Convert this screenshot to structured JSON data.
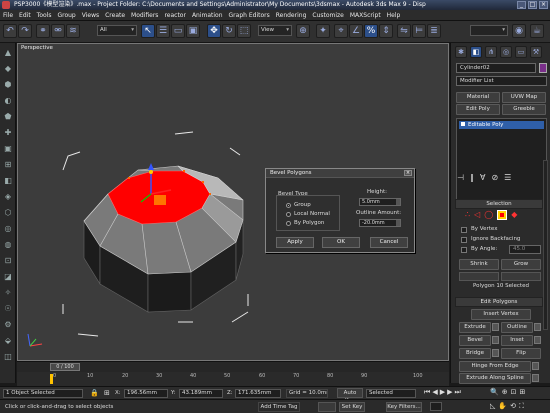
{
  "window": {
    "title": "PSP3000《模型渲染》.max  - Project Folder: C:\\Documents and Settings\\Administrator\\My Documents\\3dsmax  - Autodesk 3ds Max 9  - Disp",
    "minimize": "_",
    "maximize": "□",
    "close": "×"
  },
  "menu": [
    "File",
    "Edit",
    "Tools",
    "Group",
    "Views",
    "Create",
    "Modifiers",
    "reactor",
    "Animation",
    "Graph Editors",
    "Rendering",
    "Customize",
    "MAXScript",
    "Help"
  ],
  "toolbar": {
    "selection_filter": "All",
    "ref_coord": "View"
  },
  "viewport": {
    "label": "Perspective"
  },
  "command_panel": {
    "object_name": "Cylinder02",
    "modifier_list": "Modifier List",
    "buttons": [
      "Material",
      "UVW Map",
      "Edit Poly",
      "Greeble"
    ],
    "stack_item": "Editable Poly",
    "selection_header": "Selection",
    "by_vertex": "By Vertex",
    "ignore_backfacing": "Ignore Backfacing",
    "by_angle": "By Angle:",
    "by_angle_value": "45.0",
    "shrink": "Shrink",
    "grow": "Grow",
    "selection_status": "Polygon 10 Selected",
    "edit_polygons_header": "Edit Polygons",
    "insert_vertex": "Insert Vertex",
    "extrude": "Extrude",
    "outline": "Outline",
    "bevel": "Bevel",
    "inset": "Inset",
    "bridge": "Bridge",
    "flip": "Flip",
    "hinge_from_edge": "Hinge From Edge",
    "extrude_along_spline": "Extrude Along Spline"
  },
  "dialog": {
    "title": "Bevel Polygons",
    "close": "×",
    "bevel_type": "Bevel Type",
    "group": "Group",
    "local_normal": "Local Normal",
    "by_polygon": "By Polygon",
    "height_label": "Height:",
    "height_value": "5.0mm",
    "outline_label": "Outline Amount:",
    "outline_value": "-20.0mm",
    "apply": "Apply",
    "ok": "OK",
    "cancel": "Cancel"
  },
  "timeline": {
    "frame": "0 / 100",
    "ticks": [
      "0",
      "10",
      "20",
      "30",
      "40",
      "50",
      "60",
      "70",
      "80",
      "90",
      "100"
    ]
  },
  "status": {
    "objects_selected": "1 Object Selected",
    "prompt": "Click or click-and-drag to select objects",
    "x_label": "X:",
    "x_value": "196.56mm",
    "y_label": "Y:",
    "y_value": "43.189mm",
    "z_label": "Z:",
    "z_value": "171.635mm",
    "grid": "Grid = 10.0mm",
    "add_time_tag": "Add Time Tag",
    "auto_key": "Auto Key",
    "selected": "Selected",
    "set_key": "Set Key",
    "key_filters": "Key Filters..."
  },
  "colors": {
    "selection_red": "#ff0000",
    "viewport_bg": "#3c3c3c",
    "active_blue": "#2c4f8a"
  }
}
